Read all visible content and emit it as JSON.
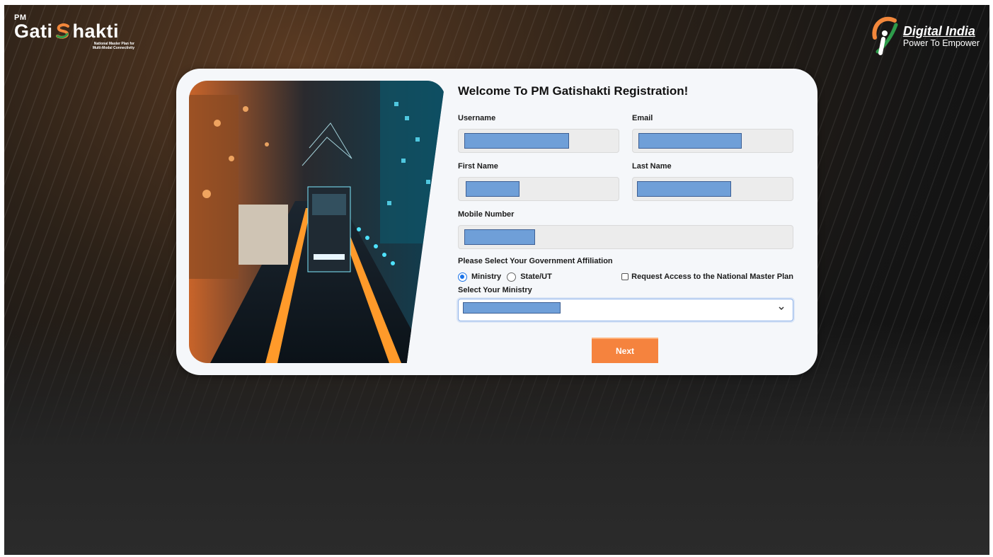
{
  "branding": {
    "left_logo": {
      "pm": "PM",
      "name_part1": "Gati",
      "name_part2": "hakti",
      "tagline_line1": "National Master Plan for",
      "tagline_line2": "Multi-Modal Connectivity"
    },
    "right_logo": {
      "title": "Digital India",
      "subtitle": "Power To Empower"
    }
  },
  "form": {
    "title": "Welcome To PM Gatishakti Registration!",
    "username_label": "Username",
    "email_label": "Email",
    "first_name_label": "First Name",
    "last_name_label": "Last Name",
    "mobile_label": "Mobile Number",
    "affiliation_label": "Please Select Your Government Affiliation",
    "option_ministry": "Ministry",
    "option_state": "State/UT",
    "selected_affiliation": "Ministry",
    "request_access_label": "Request Access to the National Master Plan",
    "request_access_checked": false,
    "ministry_select_label": "Select Your Ministry",
    "next_button": "Next"
  },
  "colors": {
    "accent": "#f5833e",
    "radio": "#1a73e8",
    "redaction": "#6f9fd8"
  },
  "icons": [
    "pm-gatishakti-logo",
    "digital-india-logo",
    "chevron-down-icon"
  ]
}
